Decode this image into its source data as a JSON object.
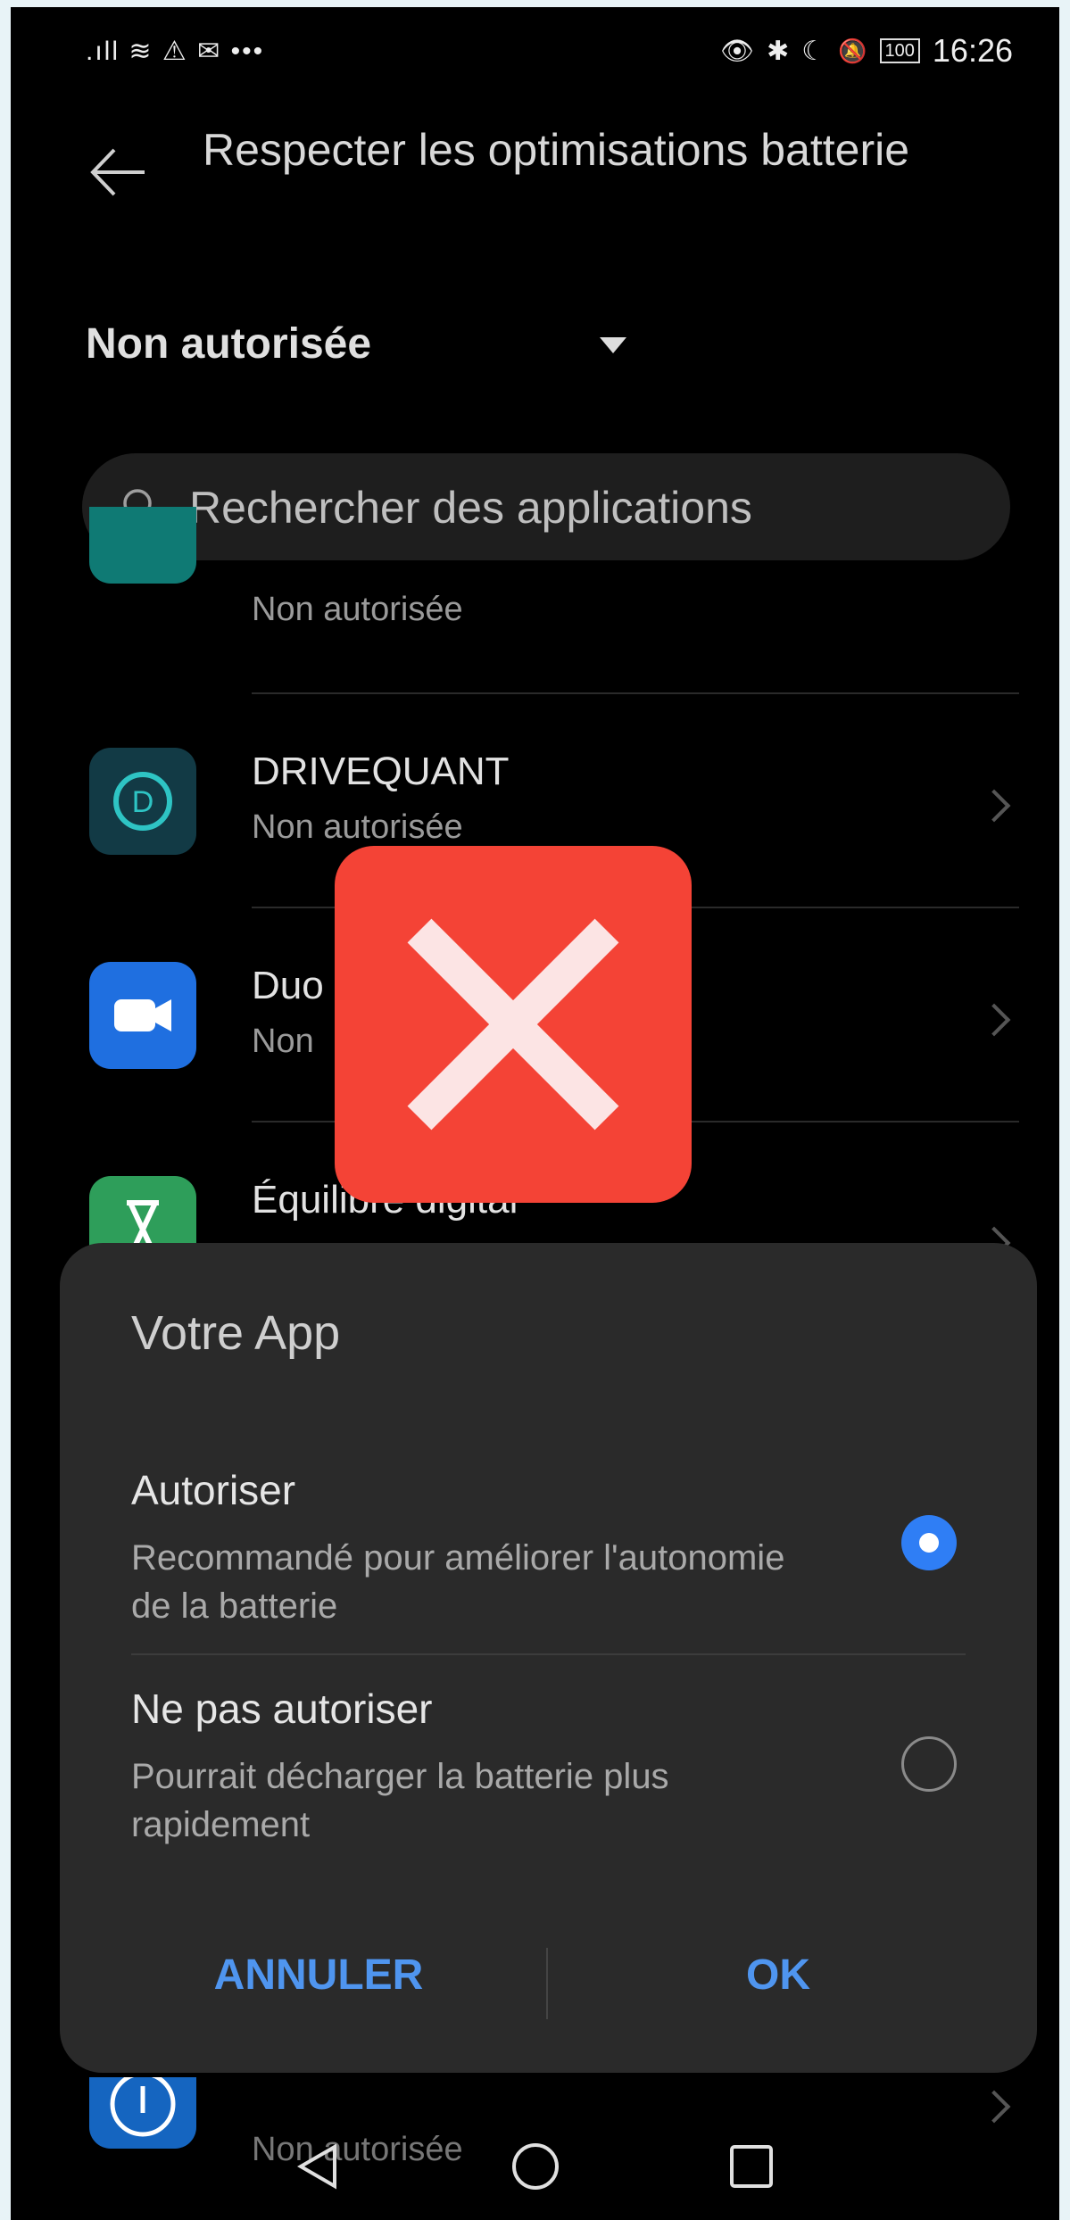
{
  "status_bar": {
    "left_icons": [
      {
        "name": "signal-icon",
        "glyph": ".ıll"
      },
      {
        "name": "wifi-icon",
        "glyph": "≋"
      },
      {
        "name": "warning-icon",
        "glyph": "⚠"
      },
      {
        "name": "mail-icon",
        "glyph": "✉"
      },
      {
        "name": "more-icon",
        "glyph": "•••"
      }
    ],
    "right_icons": [
      {
        "name": "eye-comfort-icon",
        "glyph": "👁"
      },
      {
        "name": "bluetooth-icon",
        "glyph": "✱"
      },
      {
        "name": "moon-icon",
        "glyph": "☾"
      },
      {
        "name": "silent-icon",
        "glyph": "🔕"
      }
    ],
    "battery": "100",
    "time": "16:26"
  },
  "header": {
    "title": "Respecter les optimisations batterie"
  },
  "filter": {
    "selected": "Non autorisée"
  },
  "search": {
    "placeholder": "Rechercher des applications"
  },
  "apps": [
    {
      "name": "",
      "status": "Non autorisée",
      "icon": "calculator-app-icon",
      "color": "#0f7a74"
    },
    {
      "name": "DRIVEQUANT",
      "status": "Non autorisée",
      "icon": "drivequant-app-icon",
      "color": "#123a45"
    },
    {
      "name": "Duo",
      "status": "Non",
      "icon": "duo-app-icon",
      "color": "#1f6fe0"
    },
    {
      "name": "Équilibre digital",
      "status": "",
      "icon": "digital-wellbeing-app-icon",
      "color": "#2e9e5a"
    },
    {
      "name": "",
      "status": "Non autorisée",
      "icon": "app-icon",
      "color": "#1565c0"
    }
  ],
  "overlay": {
    "icon": "close-icon",
    "color": "#f44336"
  },
  "dialog": {
    "title": "Votre App",
    "options": [
      {
        "label": "Autoriser",
        "description": "Recommandé pour améliorer l'autonomie de la batterie",
        "selected": true
      },
      {
        "label": "Ne pas autoriser",
        "description": "Pourrait décharger la batterie plus rapidement",
        "selected": false
      }
    ],
    "cancel_label": "ANNULER",
    "ok_label": "OK",
    "accent": "#4f95ef"
  },
  "navbar": {
    "back": "back-triangle-icon",
    "home": "home-circle-icon",
    "recents": "recents-square-icon"
  }
}
